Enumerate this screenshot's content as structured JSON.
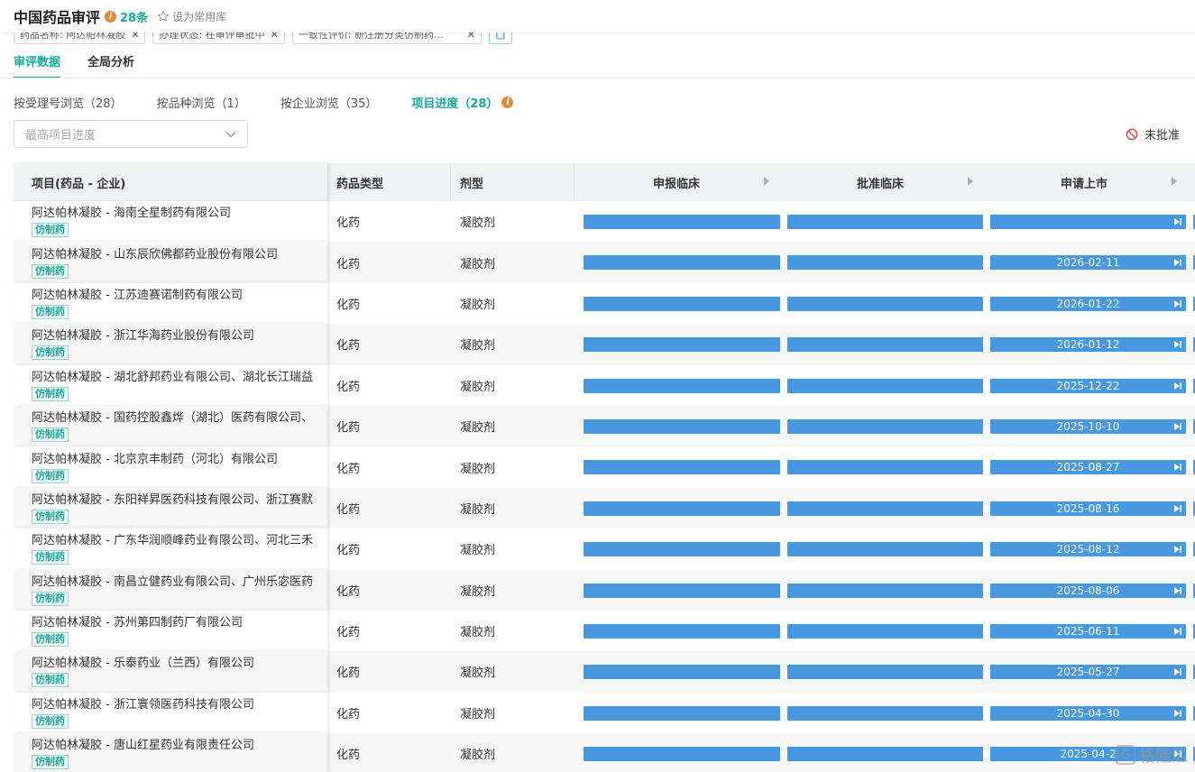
{
  "header": {
    "title": "中国药品审评",
    "count": "28条",
    "favorite_label": "设为常用库"
  },
  "filters": [
    {
      "label": "药品名称: 阿达帕林凝胶"
    },
    {
      "label": "办理状态: 在审评审批中"
    },
    {
      "label": "一致性评价: 新注册分类仿制药..."
    }
  ],
  "tabs": [
    {
      "label": "审评数据",
      "active": true
    },
    {
      "label": "全局分析",
      "active": false
    }
  ],
  "subnav": [
    {
      "label": "按受理号浏览（28）"
    },
    {
      "label": "按品种浏览（1）"
    },
    {
      "label": "按企业浏览（35）"
    },
    {
      "label": "项目进度（28）"
    }
  ],
  "progress_select": {
    "placeholder": "最高项目进度"
  },
  "legend_unapproved": "未批准",
  "table": {
    "columns": {
      "project": "项目(药品 - 企业)",
      "drug_type": "药品类型",
      "form": "剂型",
      "stage1": "申报临床",
      "stage2": "批准临床",
      "stage3": "申请上市"
    },
    "rows": [
      {
        "name": "阿达帕林凝胶 - 海南全星制药有限公司",
        "tag": "仿制药",
        "type": "化药",
        "form": "凝胶剂",
        "date": ""
      },
      {
        "name": "阿达帕林凝胶 - 山东辰欣佛都药业股份有限公司",
        "tag": "仿制药",
        "type": "化药",
        "form": "凝胶剂",
        "date": "2026-02-11"
      },
      {
        "name": "阿达帕林凝胶 - 江苏迪赛诺制药有限公司",
        "tag": "仿制药",
        "type": "化药",
        "form": "凝胶剂",
        "date": "2026-01-22"
      },
      {
        "name": "阿达帕林凝胶 - 浙江华海药业股份有限公司",
        "tag": "仿制药",
        "type": "化药",
        "form": "凝胶剂",
        "date": "2026-01-12"
      },
      {
        "name": "阿达帕林凝胶 - 湖北舒邦药业有限公司、湖北长江瑞益",
        "tag": "仿制药",
        "type": "化药",
        "form": "凝胶剂",
        "date": "2025-12-22"
      },
      {
        "name": "阿达帕林凝胶 - 国药控股鑫烨（湖北）医药有限公司、",
        "tag": "仿制药",
        "type": "化药",
        "form": "凝胶剂",
        "date": "2025-10-10"
      },
      {
        "name": "阿达帕林凝胶 - 北京京丰制药（河北）有限公司",
        "tag": "仿制药",
        "type": "化药",
        "form": "凝胶剂",
        "date": "2025-08-27"
      },
      {
        "name": "阿达帕林凝胶 - 东阳祥昇医药科技有限公司、浙江赛默",
        "tag": "仿制药",
        "type": "化药",
        "form": "凝胶剂",
        "date": "2025-08-16"
      },
      {
        "name": "阿达帕林凝胶 - 广东华润顺峰药业有限公司、河北三禾",
        "tag": "仿制药",
        "type": "化药",
        "form": "凝胶剂",
        "date": "2025-08-12"
      },
      {
        "name": "阿达帕林凝胶 - 南昌立健药业有限公司、广州乐宓医药",
        "tag": "仿制药",
        "type": "化药",
        "form": "凝胶剂",
        "date": "2025-08-06"
      },
      {
        "name": "阿达帕林凝胶 - 苏州第四制药厂有限公司",
        "tag": "仿制药",
        "type": "化药",
        "form": "凝胶剂",
        "date": "2025-06-11"
      },
      {
        "name": "阿达帕林凝胶 - 乐泰药业（兰西）有限公司",
        "tag": "仿制药",
        "type": "化药",
        "form": "凝胶剂",
        "date": "2025-05-27"
      },
      {
        "name": "阿达帕林凝胶 - 浙江寰领医药科技有限公司",
        "tag": "仿制药",
        "type": "化药",
        "form": "凝胶剂",
        "date": "2025-04-30"
      },
      {
        "name": "阿达帕林凝胶 - 唐山红星药业有限责任公司",
        "tag": "仿制药",
        "type": "化药",
        "form": "凝胶剂",
        "date": "2025-04-2"
      }
    ]
  },
  "watermark": "格隆汇",
  "colors": {
    "accent": "#1aaa9b",
    "bar": "#4898e0",
    "info": "#e08a3c",
    "forbid": "#e04b4b"
  }
}
